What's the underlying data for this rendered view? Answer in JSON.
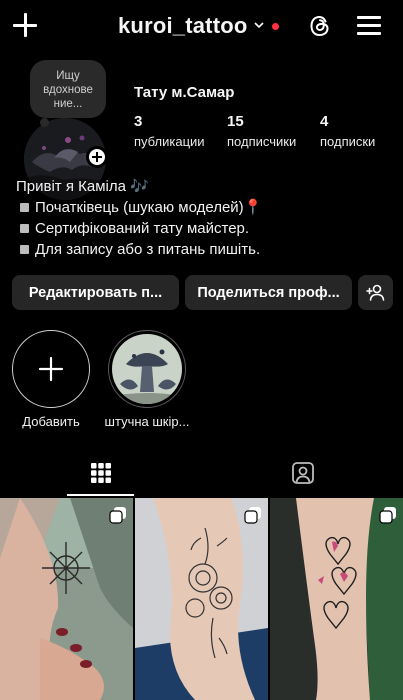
{
  "header": {
    "username": "kuroi_tattoo",
    "icons": {
      "create": "plus-icon",
      "switch": "chevron-down-icon",
      "threads": "threads-icon",
      "menu": "hamburger-menu-icon"
    },
    "notification_dot_color": "#ff3040"
  },
  "profile": {
    "note": "Ищу вдохнове ние...",
    "display_name": "Тату м.Самар",
    "stats": [
      {
        "value": "3",
        "label": "публикации"
      },
      {
        "value": "15",
        "label": "подписчики"
      },
      {
        "value": "4",
        "label": "подписки"
      }
    ],
    "bio": [
      "Привіт я Каміла 🎶",
      "Початківець (шукаю моделей)📍",
      "Сертифікований тату майстер.",
      "Для запису або з питань пишіть."
    ]
  },
  "actions": {
    "edit": "Редактировать п...",
    "share": "Поделиться проф...",
    "discover_people_icon": "add-person-icon"
  },
  "highlights": [
    {
      "label": "Добавить",
      "icon": "plus-icon"
    },
    {
      "label": "штучна шкір..."
    }
  ],
  "tabs": [
    {
      "name": "grid",
      "icon": "grid-icon",
      "active": true
    },
    {
      "name": "tagged",
      "icon": "tagged-person-icon",
      "active": false
    }
  ],
  "posts": [
    {
      "description": "compass tattoo on wrist",
      "multiple": true
    },
    {
      "description": "floral peony tattoo on forearm",
      "multiple": true
    },
    {
      "description": "heart chain tattoo on arm",
      "multiple": true
    }
  ],
  "colors": {
    "background": "#000000",
    "button": "#262626",
    "accent_red": "#ff3040"
  }
}
